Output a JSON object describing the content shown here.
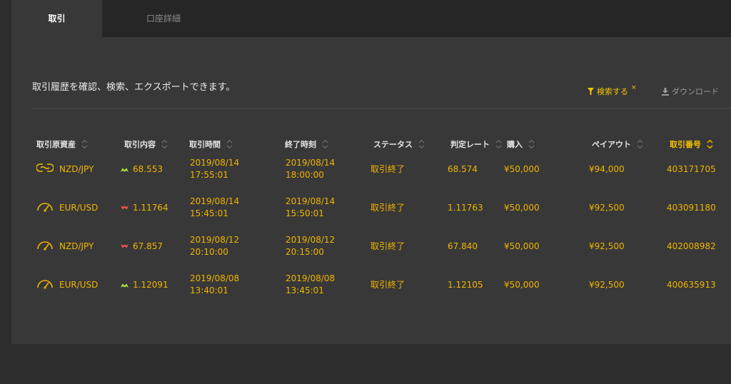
{
  "tabs": [
    {
      "label": "取引",
      "active": true
    },
    {
      "label": "口座詳細",
      "active": false
    }
  ],
  "description": "取引履歴を確認、検索、エクスポートできます。",
  "actions": {
    "search_label": "検索する",
    "search_sup": "×",
    "download_label": "ダウンロード"
  },
  "columns": [
    {
      "label": "取引原資産",
      "sorted": false
    },
    {
      "label": "取引内容",
      "sorted": false
    },
    {
      "label": "取引時間",
      "sorted": false
    },
    {
      "label": "終了時刻",
      "sorted": false
    },
    {
      "label": "ステータス",
      "sorted": false
    },
    {
      "label": "判定レート",
      "sorted": false
    },
    {
      "label": "購入",
      "sorted": false
    },
    {
      "label": "ペイアウト",
      "sorted": false
    },
    {
      "label": "取引番号",
      "sorted": true
    }
  ],
  "rows": [
    {
      "icon": "chain-link-icon",
      "asset": "NZD/JPY",
      "direction": "up",
      "rate": "68.553",
      "trade_date": "2019/08/14",
      "trade_time": "17:55:01",
      "end_date": "2019/08/14",
      "end_time": "18:00:00",
      "status": "取引終了",
      "judge_rate": "68.574",
      "purchase": "¥50,000",
      "payout": "¥94,000",
      "trade_id": "403171705"
    },
    {
      "icon": "gauge-icon",
      "asset": "EUR/USD",
      "direction": "down",
      "rate": "1.11764",
      "trade_date": "2019/08/14",
      "trade_time": "15:45:01",
      "end_date": "2019/08/14",
      "end_time": "15:50:01",
      "status": "取引終了",
      "judge_rate": "1.11763",
      "purchase": "¥50,000",
      "payout": "¥92,500",
      "trade_id": "403091180"
    },
    {
      "icon": "gauge-icon",
      "asset": "NZD/JPY",
      "direction": "down",
      "rate": "67.857",
      "trade_date": "2019/08/12",
      "trade_time": "20:10:00",
      "end_date": "2019/08/12",
      "end_time": "20:15:00",
      "status": "取引終了",
      "judge_rate": "67.840",
      "purchase": "¥50,000",
      "payout": "¥92,500",
      "trade_id": "402008982"
    },
    {
      "icon": "gauge-icon",
      "asset": "EUR/USD",
      "direction": "up",
      "rate": "1.12091",
      "trade_date": "2019/08/08",
      "trade_time": "13:40:01",
      "end_date": "2019/08/08",
      "end_time": "13:45:01",
      "status": "取引終了",
      "judge_rate": "1.12105",
      "purchase": "¥50,000",
      "payout": "¥92,500",
      "trade_id": "400635913"
    }
  ],
  "colors": {
    "accent": "#f5c400",
    "value": "#f0b400",
    "up": "#b6e23c",
    "down": "#f2554b",
    "panel": "#383838",
    "background": "#2d2d2d"
  }
}
